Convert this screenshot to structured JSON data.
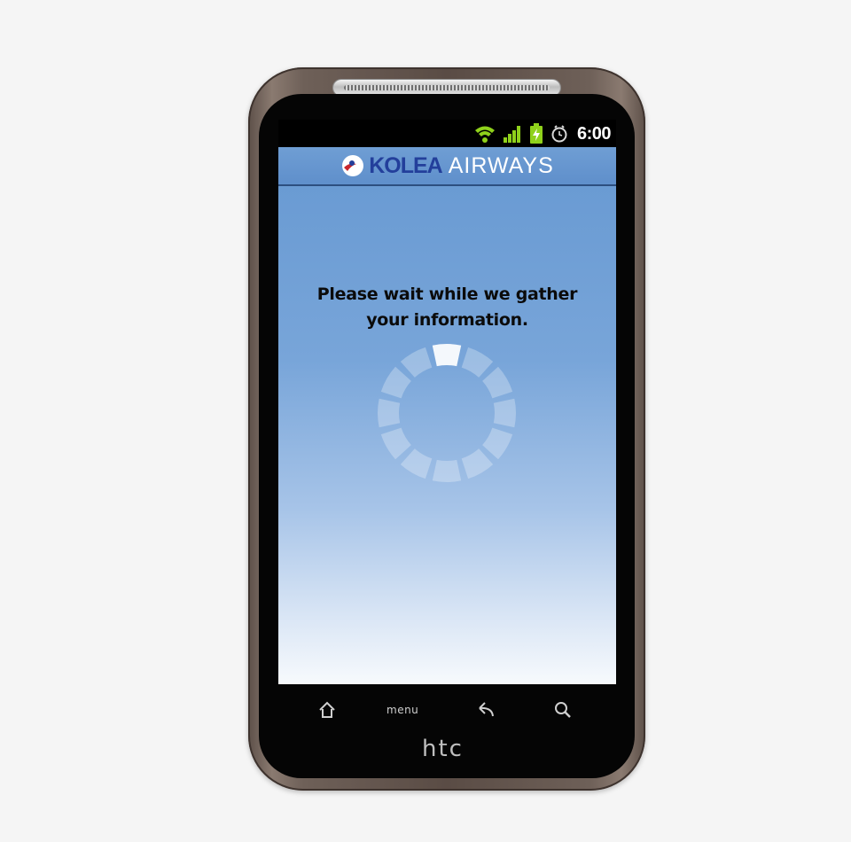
{
  "device": {
    "brand_logo": "htc"
  },
  "status_bar": {
    "time": "6:00",
    "icons": [
      "wifi-icon",
      "signal-icon",
      "battery-charging-icon",
      "alarm-icon"
    ],
    "icon_color": "#8fd11b"
  },
  "app": {
    "brand_part_1": "KOLEA",
    "brand_part_2": "AIRWAYS",
    "brand_color_primary": "#233f9b",
    "header_color": "#6f9ed4"
  },
  "main": {
    "wait_message_line1": "Please wait while we gather",
    "wait_message_line2": "your information."
  },
  "spinner": {
    "segments": 12,
    "active_segment": 0
  },
  "nav_bar": {
    "buttons": [
      "home-icon",
      "menu",
      "back-icon",
      "search-icon"
    ],
    "menu_label": "menu"
  }
}
